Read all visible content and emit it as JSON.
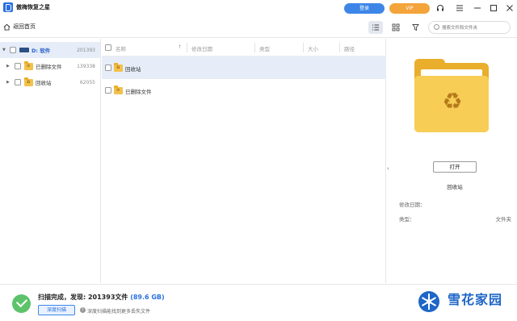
{
  "titlebar": {
    "app_title": "傲梅恢复之星",
    "login_label": "登录",
    "vip_label": "VIP"
  },
  "toolbar": {
    "back_label": "返回首页",
    "search_placeholder": "搜索文件和文件夹"
  },
  "tree": {
    "items": [
      {
        "label": "D: 软件",
        "count": "201393"
      },
      {
        "label": "已删除文件",
        "count": "139338"
      },
      {
        "label": "回收站",
        "count": "62055"
      }
    ]
  },
  "file_list": {
    "columns": [
      "名称",
      "修改日期",
      "类型",
      "大小",
      "路径"
    ],
    "rows": [
      {
        "name": "回收站"
      },
      {
        "name": "已删除文件"
      }
    ]
  },
  "preview": {
    "open_label": "打开",
    "name": "回收站",
    "modified_label": "修改日期：",
    "type_label": "类型：",
    "type_value": "文件夹"
  },
  "status": {
    "text": "扫描完成，发现: 201393文件",
    "size": "(89.6 GB)",
    "deep_scan_label": "深度扫描",
    "hint": "深度扫描能找到更多丢失文件"
  },
  "watermark": {
    "text": "雪花家园"
  },
  "colors": {
    "accent": "#3d86e8",
    "vip": "#f3a43a",
    "success": "#5cc36a",
    "folder": "#f7cd56"
  }
}
